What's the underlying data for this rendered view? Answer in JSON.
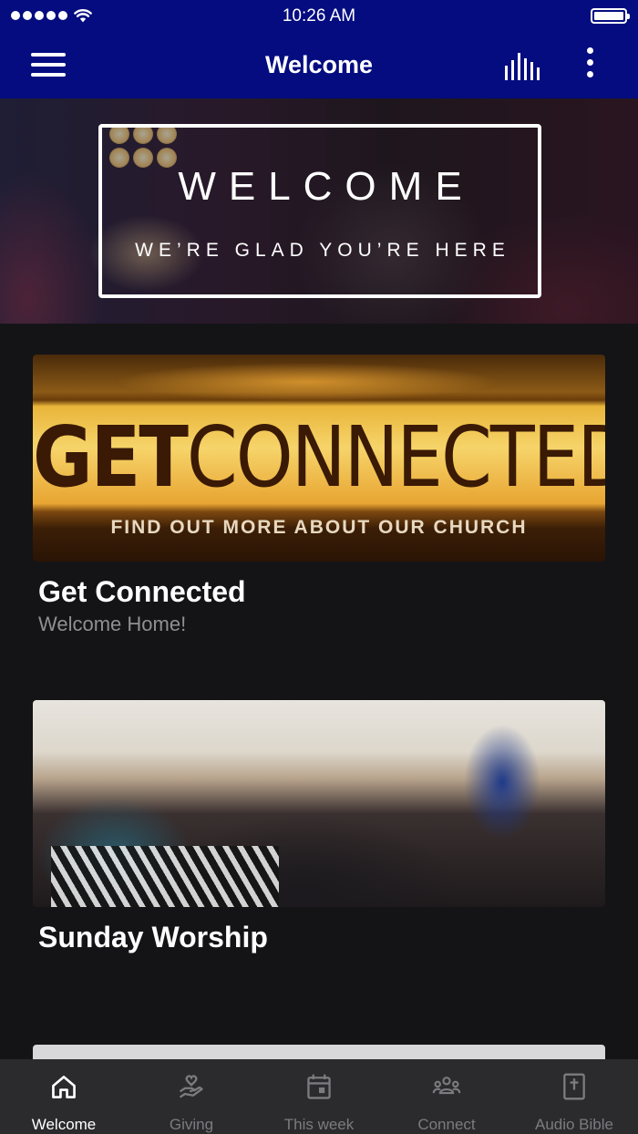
{
  "status_bar": {
    "time": "10:26 AM",
    "signal_bars": 5,
    "wifi": true,
    "battery_percent": 100
  },
  "nav": {
    "title": "Welcome",
    "menu_icon": "hamburger-menu-icon",
    "audio_icon": "audio-bars-icon",
    "more_icon": "more-vertical-icon"
  },
  "hero": {
    "title": "WELCOME",
    "subtitle": "WE’RE GLAD YOU’RE HERE"
  },
  "cards": [
    {
      "banner_bold": "GET",
      "banner_thin": "CONNECTED",
      "banner_tagline": "FIND OUT MORE ABOUT OUR CHURCH",
      "title": "Get Connected",
      "subtitle": "Welcome Home!"
    },
    {
      "title": "Sunday Worship"
    }
  ],
  "tabs": [
    {
      "label": "Welcome",
      "icon": "home-icon",
      "active": true
    },
    {
      "label": "Giving",
      "icon": "giving-heart-hand-icon",
      "active": false
    },
    {
      "label": "This week",
      "icon": "calendar-icon",
      "active": false
    },
    {
      "label": "Connect",
      "icon": "people-group-icon",
      "active": false
    },
    {
      "label": "Audio Bible",
      "icon": "bible-icon",
      "active": false
    }
  ],
  "colors": {
    "header_bg": "#040c80",
    "page_bg": "#141416",
    "tab_bar_bg": "#2b2b2e",
    "tab_active": "#ffffff",
    "tab_inactive": "#7b7b80",
    "subtitle_text": "#8f8f94"
  }
}
